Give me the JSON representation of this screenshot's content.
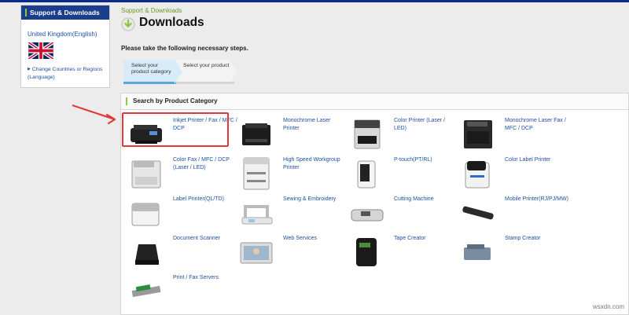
{
  "sidebar": {
    "heading": "Support & Downloads",
    "country": "United Kingdom(English)",
    "change_link": "Change Countries or Regions (Language)"
  },
  "breadcrumb": "Support & Downloads",
  "page_title": "Downloads",
  "steps_intro": "Please take the following necessary steps.",
  "steps": [
    {
      "label": "Select your product category",
      "active": true
    },
    {
      "label": "Select your product",
      "active": false
    }
  ],
  "search_heading": "Search by Product Category",
  "categories": [
    {
      "label": "Inkjet Printer / Fax / MFC / DCP",
      "icon": "inkjet-printer-icon"
    },
    {
      "label": "Monochrome Laser Printer",
      "icon": "laser-printer-icon"
    },
    {
      "label": "Color Printer (Laser / LED)",
      "icon": "color-printer-icon"
    },
    {
      "label": "Monochrome Laser Fax / MFC / DCP",
      "icon": "laser-mfc-icon"
    },
    {
      "label": "Color Fax / MFC / DCP (Laser / LED)",
      "icon": "color-mfc-icon"
    },
    {
      "label": "High Speed Workgroup Printer",
      "icon": "workgroup-printer-icon"
    },
    {
      "label": "P-touch(PT/RL)",
      "icon": "ptouch-icon"
    },
    {
      "label": "Color Label Printer",
      "icon": "color-label-printer-icon"
    },
    {
      "label": "Label Printer(QL/TD)",
      "icon": "label-printer-icon"
    },
    {
      "label": "Sewing & Embroidery",
      "icon": "sewing-machine-icon"
    },
    {
      "label": "Cutting Machine",
      "icon": "cutting-machine-icon"
    },
    {
      "label": "Mobile Printer(RJ/PJ/MW)",
      "icon": "mobile-printer-icon"
    },
    {
      "label": "Document Scanner",
      "icon": "document-scanner-icon"
    },
    {
      "label": "Web Services",
      "icon": "web-services-icon"
    },
    {
      "label": "Tape Creator",
      "icon": "tape-creator-icon"
    },
    {
      "label": "Stamp Creator",
      "icon": "stamp-creator-icon"
    },
    {
      "label": "Print / Fax Servers",
      "icon": "print-server-icon"
    }
  ],
  "watermark": "wsxdn.com"
}
